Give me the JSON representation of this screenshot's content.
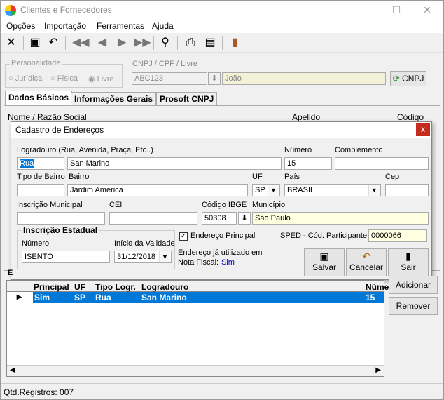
{
  "window": {
    "title": "Clientes e Fornecedores"
  },
  "menu": [
    "Opções",
    "Importação",
    "Ferramentas",
    "Ajuda"
  ],
  "personalidade": {
    "title": "Personalidade",
    "options": [
      "Jurídica",
      "Física",
      "Livre"
    ]
  },
  "cnpj": {
    "label": "CNPJ / CPF / Livre",
    "value": "ABC123",
    "name": "João",
    "button": "CNPJ"
  },
  "tabs": [
    "Dados Básicos",
    "Informações Gerais",
    "Prosoft CNPJ"
  ],
  "main_labels": {
    "nome": "Nome / Razão Social",
    "apelido": "Apelido",
    "codigo": "Código"
  },
  "dialog": {
    "title": "Cadastro de Endereços",
    "close": "x",
    "logradouro_label": "Logradouro (Rua, Avenida, Praça, Etc..)",
    "tipo_logr": "Rua",
    "logradouro": "San Marino",
    "numero_label": "Número",
    "numero": "15",
    "complemento_label": "Complemento",
    "complemento": "",
    "tipo_bairro_label": "Tipo de Bairro",
    "tipo_bairro": "",
    "bairro_label": "Bairro",
    "bairro": "Jardim America",
    "uf_label": "UF",
    "uf": "SP",
    "pais_label": "País",
    "pais": "BRASIL",
    "cep_label": "Cep",
    "cep": "",
    "im_label": "Inscrição Municipal",
    "im": "",
    "cei_label": "CEI",
    "cei": "",
    "ibge_label": "Código IBGE",
    "ibge": "50308",
    "municipio_label": "Município",
    "municipio": "São Paulo",
    "ie_group": "Inscrição Estadual",
    "ie_numero_label": "Número",
    "ie_numero": "ISENTO",
    "ie_inicio_label": "Início da Validade",
    "ie_inicio": "31/12/2018",
    "endereco_principal": "Endereço Principal",
    "sped_label": "SPED - Cód. Participante:",
    "sped": "0000066",
    "nf_label1": "Endereço já utilizado em",
    "nf_label2": "Nota Fiscal:",
    "nf_value": "Sim",
    "btn_salvar": "Salvar",
    "btn_cancelar": "Cancelar",
    "btn_sair": "Sair"
  },
  "grid": {
    "group_label": "E",
    "headers": [
      "Principal",
      "UF",
      "Tipo Logr.",
      "Logradouro",
      "Núme"
    ],
    "row": [
      "Sim",
      "SP",
      "Rua",
      "San Marino",
      "15"
    ]
  },
  "side_buttons": {
    "adicionar": "Adicionar",
    "remover": "Remover"
  },
  "status": "Qtd.Registros: 007",
  "colors": {
    "selection": "#0078d7",
    "yellow": "#ffffe1",
    "close": "#c42b1c",
    "link": "#0000cc"
  }
}
